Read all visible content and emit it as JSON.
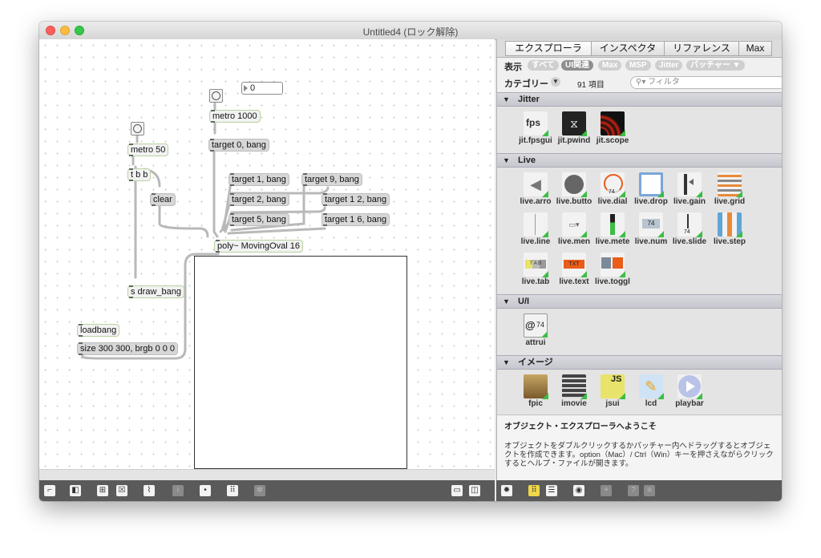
{
  "window": {
    "title": "Untitled4 (ロック解除)"
  },
  "patch": {
    "objects": {
      "metro1000": "metro 1000",
      "number": "0",
      "metro50": "metro 50",
      "target0": "target 0, bang",
      "tbb": "t b b",
      "clear": "clear",
      "target1": "target 1, bang",
      "target9": "target 9, bang",
      "target2": "target 2, bang",
      "target12": "target 1 2, bang",
      "target5": "target 5, bang",
      "target16": "target 1 6, bang",
      "poly": "poly~ MovingOval 16",
      "sdraw": "s draw_bang",
      "loadbang": "loadbang",
      "size": "size 300 300, brgb 0 0 0"
    }
  },
  "sidebar": {
    "tabs": [
      "エクスプローラ",
      "インスペクタ",
      "リファレンス",
      "Max"
    ],
    "filter_label": "表示",
    "filters": [
      "すべて",
      "UI関連",
      "Max",
      "MSP",
      "Jitter",
      "パッチャー ▼"
    ],
    "category_label": "カテゴリー",
    "category_btn": "▼",
    "item_count": "91 項目",
    "search_placeholder": "フィルタ",
    "sections": [
      {
        "name": "Jitter",
        "items": [
          {
            "name": "jit.fpsgui",
            "icon": "fps-icon"
          },
          {
            "name": "jit.pwind",
            "icon": "pwind-icon"
          },
          {
            "name": "jit.scope",
            "icon": "scope-icon"
          }
        ]
      },
      {
        "name": "Live",
        "items": [
          {
            "name": "live.arro",
            "icon": "arrow-icon"
          },
          {
            "name": "live.butto",
            "icon": "button-icon"
          },
          {
            "name": "live.dial",
            "icon": "dial-icon"
          },
          {
            "name": "live.drop",
            "icon": "drop-icon"
          },
          {
            "name": "live.gain",
            "icon": "gain-icon"
          },
          {
            "name": "live.grid",
            "icon": "grid-icon"
          },
          {
            "name": "live.line",
            "icon": "line-icon"
          },
          {
            "name": "live.men",
            "icon": "menu-icon"
          },
          {
            "name": "live.mete",
            "icon": "meter-icon"
          },
          {
            "name": "live.num",
            "icon": "numbox-icon"
          },
          {
            "name": "live.slide",
            "icon": "slider-icon"
          },
          {
            "name": "live.step",
            "icon": "step-icon"
          },
          {
            "name": "live.tab",
            "icon": "tab-icon"
          },
          {
            "name": "live.text",
            "icon": "text-icon"
          },
          {
            "name": "live.toggl",
            "icon": "toggle-icon"
          }
        ]
      },
      {
        "name": "U/I",
        "items": [
          {
            "name": "attrui",
            "icon": "attrui-icon"
          }
        ]
      },
      {
        "name": "イメージ",
        "items": [
          {
            "name": "fpic",
            "icon": "picture-icon"
          },
          {
            "name": "imovie",
            "icon": "film-icon"
          },
          {
            "name": "jsui",
            "icon": "js-icon"
          },
          {
            "name": "lcd",
            "icon": "pencil-icon"
          },
          {
            "name": "playbar",
            "icon": "play-icon"
          }
        ]
      }
    ],
    "icon_text": {
      "fps": "fps",
      "dial": "74",
      "num": "74",
      "slide": "74",
      "tab_a": "T",
      "tab_b": "A",
      "tab_c": "B",
      "txt": "TXT",
      "attrui_at": "@",
      "attrui_val": "74",
      "js": "JS"
    },
    "welcome_title": "オブジェクト・エクスプローラへようこそ",
    "welcome_text": "オブジェクトをダブルクリックするかパッチャー内へドラッグするとオブジェクトを作成できます。option（Mac）/ Ctrl（Win）キーを押さえながらクリックするとヘルプ・ファイルが開きます。"
  },
  "colors": {
    "accent_green": "#3cbd45",
    "section_header": "#c6c6cf",
    "toolbar": "#5a5a5a"
  }
}
